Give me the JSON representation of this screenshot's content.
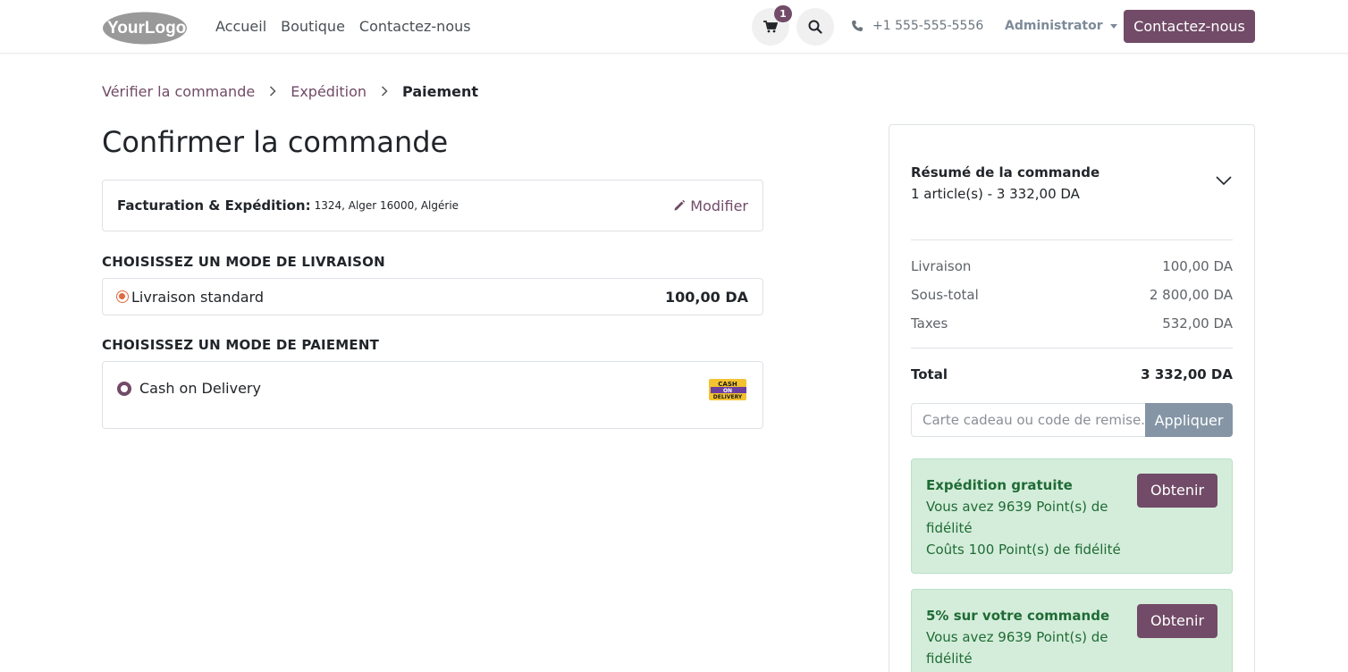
{
  "header": {
    "logo_text": "YourLogo",
    "nav": [
      "Accueil",
      "Boutique",
      "Contactez-nous"
    ],
    "cart_count": "1",
    "phone": "+1 555-555-5556",
    "user": "Administrator",
    "contact_button": "Contactez-nous"
  },
  "breadcrumb": {
    "step1": "Vérifier la commande",
    "step2": "Expédition",
    "step3": "Paiement"
  },
  "page_title": "Confirmer la commande",
  "billing": {
    "label": "Facturation & Expédition:",
    "address": "1324, Alger 16000, Algérie",
    "edit_label": "Modifier"
  },
  "delivery": {
    "section_title": "CHOISISSEZ UN MODE DE LIVRAISON",
    "method": "Livraison standard",
    "price": "100,00 DA"
  },
  "payment": {
    "section_title": "CHOISISSEZ UN MODE DE PAIEMENT",
    "method": "Cash on Delivery",
    "logo_text_1": "CASH",
    "logo_text_2": "ON",
    "logo_text_3": "DELIVERY"
  },
  "summary": {
    "title": "Résumé de la commande",
    "subtitle": "1 article(s) -  3 332,00 DA",
    "lines": [
      {
        "label": "Livraison",
        "value": "100,00 DA"
      },
      {
        "label": "Sous-total",
        "value": "2 800,00 DA"
      },
      {
        "label": "Taxes",
        "value": "532,00 DA"
      }
    ],
    "total_label": "Total",
    "total_value": "3 332,00 DA",
    "promo_placeholder": "Carte cadeau ou code de remise...",
    "promo_button": "Appliquer",
    "rewards": [
      {
        "title": "Expédition gratuite",
        "line1": "Vous avez 9639 Point(s) de fidélité",
        "line2": "Coûts 100 Point(s) de fidélité",
        "button": "Obtenir"
      },
      {
        "title": "5% sur votre commande",
        "line1": "Vous avez 9639 Point(s) de fidélité",
        "line2": "",
        "button": "Obtenir"
      }
    ]
  },
  "colors": {
    "brand": "#714b67",
    "reward_bg": "#d4edda",
    "reward_text": "#1f6b35",
    "apply_button": "#8595a6"
  }
}
